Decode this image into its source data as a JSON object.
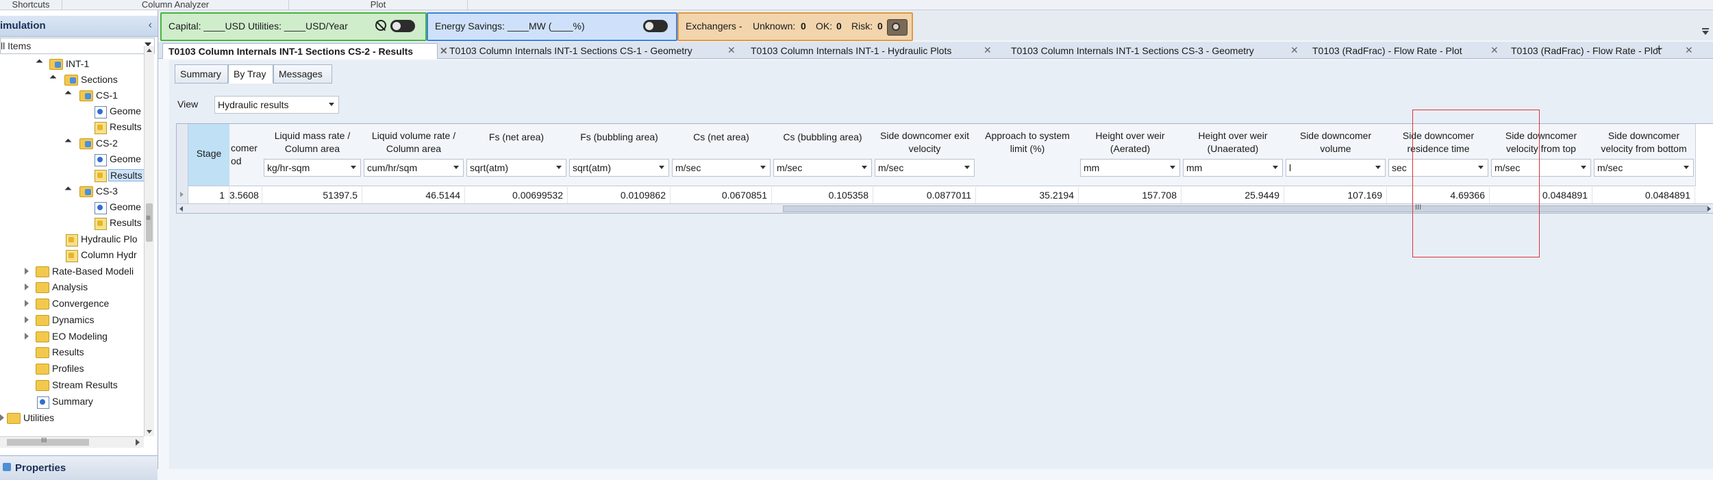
{
  "ribbon": {
    "groups": [
      "Shortcuts",
      "Column Analyzer",
      "Plot"
    ]
  },
  "nav": {
    "title": "imulation",
    "filter": "ll Items",
    "tree": [
      {
        "label": "INT-1",
        "icon": "folder-blue-icon"
      },
      {
        "label": "Sections",
        "icon": "folder-blue-icon"
      },
      {
        "label": "CS-1",
        "icon": "folder-blue-icon"
      },
      {
        "label": "Geome",
        "icon": "form-blue-icon"
      },
      {
        "label": "Results",
        "icon": "form-yellow-icon"
      },
      {
        "label": "CS-2",
        "icon": "folder-blue-icon"
      },
      {
        "label": "Geome",
        "icon": "form-blue-icon"
      },
      {
        "label": "Results",
        "icon": "form-yellow-icon"
      },
      {
        "label": "CS-3",
        "icon": "folder-blue-icon"
      },
      {
        "label": "Geome",
        "icon": "form-blue-icon"
      },
      {
        "label": "Results",
        "icon": "form-yellow-icon"
      },
      {
        "label": "Hydraulic Plo",
        "icon": "form-yellow-icon"
      },
      {
        "label": "Column Hydr",
        "icon": "form-yellow-icon"
      },
      {
        "label": "Rate-Based Modeli",
        "icon": "folder-icon"
      },
      {
        "label": "Analysis",
        "icon": "folder-icon"
      },
      {
        "label": "Convergence",
        "icon": "folder-icon"
      },
      {
        "label": "Dynamics",
        "icon": "folder-icon"
      },
      {
        "label": "EO Modeling",
        "icon": "folder-icon"
      },
      {
        "label": "Results",
        "icon": "folder-icon"
      },
      {
        "label": "Profiles",
        "icon": "folder-icon"
      },
      {
        "label": "Stream Results",
        "icon": "folder-icon"
      },
      {
        "label": "Summary",
        "icon": "summary-icon"
      },
      {
        "label": "Utilities",
        "icon": "folder-icon"
      }
    ],
    "hscroll_grip": "III",
    "vscroll_grip": "≡",
    "properties": "Properties"
  },
  "dashboard": {
    "capital": "Capital: ____USD   Utilities: ____USD/Year",
    "energy": "Energy Savings: ____MW    (____%)",
    "exchangers_label": "Exchangers -",
    "unknown_label": "Unknown:",
    "unknown_value": "0",
    "ok_label": "OK:",
    "ok_value": "0",
    "risk_label": "Risk:",
    "risk_value": "0"
  },
  "doc_tabs": [
    {
      "label": "T0103 Column Internals INT-1 Sections CS-2 - Results",
      "active": true
    },
    {
      "label": "T0103 Column Internals INT-1 Sections CS-1 - Geometry",
      "active": false
    },
    {
      "label": "T0103 Column Internals INT-1 - Hydraulic Plots",
      "active": false
    },
    {
      "label": "T0103 Column Internals INT-1 Sections CS-3 - Geometry",
      "active": false
    },
    {
      "label": "T0103 (RadFrac) - Flow Rate - Plot",
      "active": false
    },
    {
      "label": "T0103 (RadFrac) - Flow Rate - Plot",
      "active": false
    }
  ],
  "doc_tab_close": "✕",
  "doc_tab_add": "+",
  "sub_tabs": [
    "Summary",
    "By Tray",
    "Messages"
  ],
  "view": {
    "label": "View",
    "value": "Hydraulic results"
  },
  "grid": {
    "stage_header": "Stage",
    "columns": [
      {
        "title": "comer\nod",
        "unit": ""
      },
      {
        "title": "Liquid mass rate /\nColumn area",
        "unit": "kg/hr-sqm"
      },
      {
        "title": "Liquid volume rate /\nColumn area",
        "unit": "cum/hr/sqm"
      },
      {
        "title": "Fs (net area)",
        "unit": "sqrt(atm)"
      },
      {
        "title": "Fs (bubbling area)",
        "unit": "sqrt(atm)"
      },
      {
        "title": "Cs (net area)",
        "unit": "m/sec"
      },
      {
        "title": "Cs (bubbling area)",
        "unit": "m/sec"
      },
      {
        "title": "Side downcomer exit\nvelocity",
        "unit": "m/sec"
      },
      {
        "title": "Approach to system\nlimit (%)",
        "unit": ""
      },
      {
        "title": "Height over weir\n(Aerated)",
        "unit": "mm"
      },
      {
        "title": "Height over weir\n(Unaerated)",
        "unit": "mm"
      },
      {
        "title": "Side downcomer\nvolume",
        "unit": "l"
      },
      {
        "title": "Side downcomer\nresidence time",
        "unit": "sec"
      },
      {
        "title": "Side downcomer\nvelocity from top",
        "unit": "m/sec"
      },
      {
        "title": "Side downcomer\nvelocity from bottom",
        "unit": "m/sec"
      }
    ],
    "rows": [
      {
        "stage": "1",
        "values": [
          "3.5608",
          "51397.5",
          "46.5144",
          "0.00699532",
          "0.0109862",
          "0.0670851",
          "0.105358",
          "0.0877011",
          "35.2194",
          "157.708",
          "25.9449",
          "107.169",
          "4.69366",
          "0.0484891",
          "0.0484891"
        ]
      }
    ],
    "hscroll_grip": "III"
  }
}
